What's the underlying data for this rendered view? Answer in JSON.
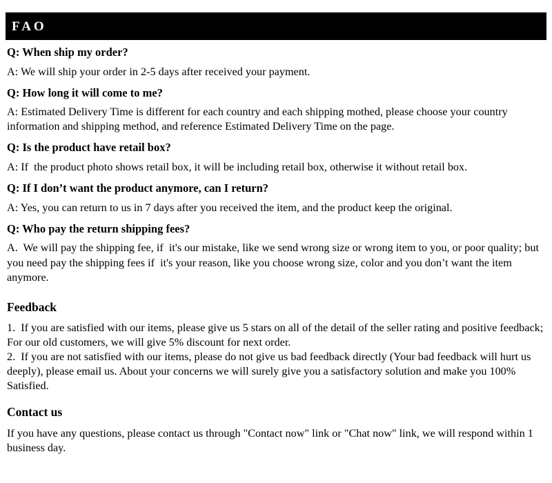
{
  "header": {
    "title": "FAO",
    "background_color": "#000000",
    "text_color": "#ffffff"
  },
  "faq": {
    "items": [
      {
        "question": "Q: When ship my order?",
        "answer": "A: We will ship your order in 2-5 days after received your payment."
      },
      {
        "question": "Q: How long it will come to me?",
        "answer": "A: Estimated Delivery Time is different for each country and each shipping mothed, please choose your country information and shipping method, and reference Estimated Delivery Time on the page."
      },
      {
        "question": "Q: Is the product have retail box?",
        "answer": "A: If  the product photo shows retail box, it will be including retail box, otherwise it without retail box."
      },
      {
        "question": "Q: If I don’t want the product anymore, can I return?",
        "answer": "A: Yes, you can return to us in 7 days after you received the item, and the product keep the original."
      },
      {
        "question": "Q: Who pay the return shipping fees?",
        "answer": "A.  We will pay the shipping fee, if  it's our mistake, like we send wrong size or wrong item to you, or poor quality; but you need pay the shipping fees if  it's your reason, like you choose wrong size, color and you don’t want the item anymore."
      }
    ]
  },
  "feedback": {
    "heading": "Feedback",
    "paragraphs": [
      "1.  If you are satisfied with our items, please give us 5 stars on all of the detail of the seller rating and positive feedback; For our old customers, we will give 5% discount for next order.",
      "2.  If you are not satisfied with our items, please do not give us bad feedback directly (Your bad feedback will hurt us deeply), please email us. About your concerns we will surely give you a satisfactory solution and make you 100% Satisfied."
    ]
  },
  "contact": {
    "heading": "Contact us",
    "paragraphs": [
      "If you have any questions, please contact us through \"Contact now\" link or \"Chat now\" link, we will respond within 1 business day."
    ]
  }
}
